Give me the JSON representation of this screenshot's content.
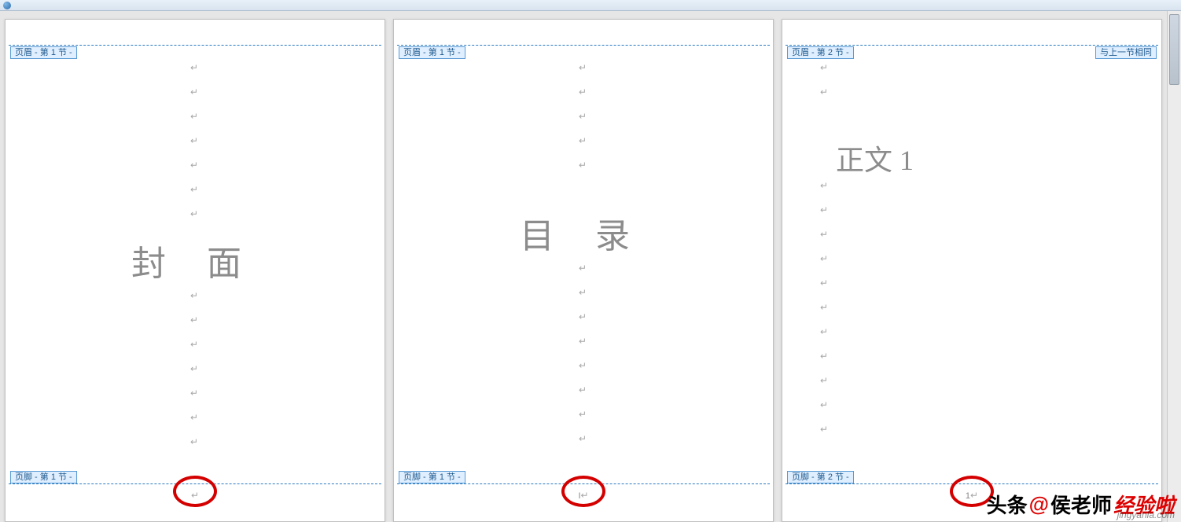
{
  "titlebar": {
    "app_icon": "word-orb"
  },
  "tags": {
    "header_section1": "页眉 - 第 1 节 -",
    "header_section2": "页眉 - 第 2 节 -",
    "footer_section1": "页脚 - 第 1 节 -",
    "footer_section2": "页脚 - 第 2 节 -",
    "same_as_previous": "与上一节相同"
  },
  "pages": [
    {
      "title": "封面",
      "footer_text": ""
    },
    {
      "title": "目录",
      "footer_text": "I"
    },
    {
      "title": "正文 1",
      "footer_text": "1"
    }
  ],
  "paragraph_mark": "↵",
  "watermark": {
    "prefix": "头条",
    "at": "@",
    "name": "侯老师",
    "brand": "经验啦",
    "url": "jingyanla.com"
  }
}
